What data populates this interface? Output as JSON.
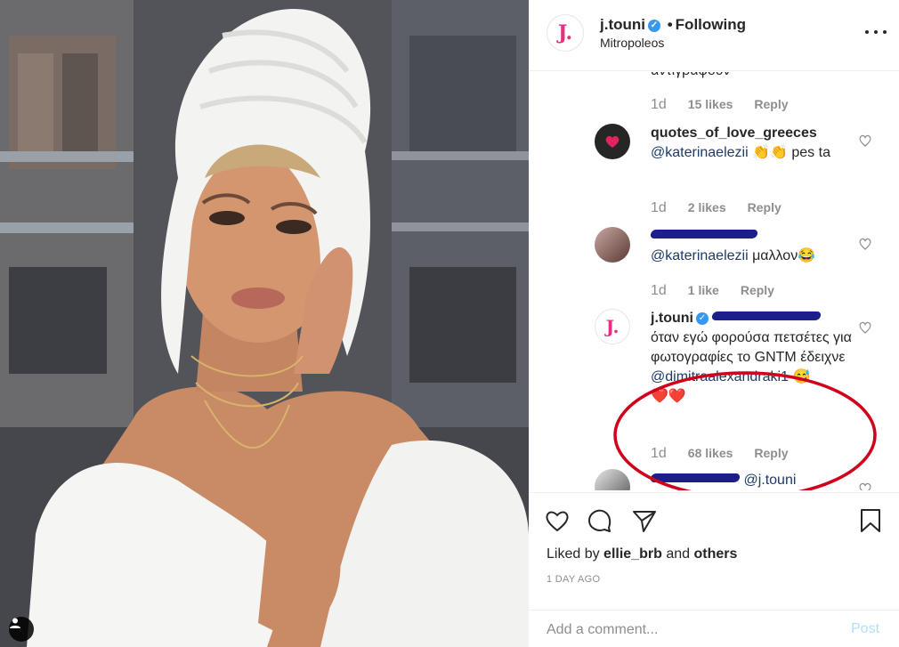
{
  "post": {
    "username": "j.touni",
    "avatar_letter": "J.",
    "follow_status": "Following",
    "location": "Mitropoleos"
  },
  "comments": {
    "fragment_text": "αντιγραφουν",
    "first_meta": {
      "ago": "1d",
      "likes": "15 likes",
      "reply": "Reply"
    },
    "items": [
      {
        "username": "quotes_of_love_greeces",
        "mention": "@katerinaelezii",
        "emoji": "👏👏",
        "text": "pes ta",
        "ago": "1d",
        "likes": "2 likes",
        "reply": "Reply"
      },
      {
        "username_redacted": true,
        "mention": "@katerinaelezii",
        "text": "μαλλον",
        "emoji": "😂",
        "ago": "1d",
        "likes": "1 like",
        "reply": "Reply"
      },
      {
        "username": "j.touni",
        "mention_redacted": true,
        "text": "όταν εγώ φορούσα πετσέτες για φωτογραφίες το GNTM έδειχνε",
        "mention": "@dimitraalexandraki1",
        "emoji": "😅",
        "emoji_after": "❤️❤️",
        "ago": "1d",
        "likes": "68 likes",
        "reply": "Reply"
      },
      {
        "username_redacted": true,
        "mention": "@j.touni"
      }
    ]
  },
  "liked_by": {
    "prefix": "Liked by",
    "user": "ellie_brb",
    "and": "and",
    "others": "others"
  },
  "date": "1 DAY AGO",
  "add_comment": {
    "placeholder": "Add a comment...",
    "post_label": "Post"
  },
  "icons": [
    "heart-icon",
    "comment-icon",
    "share-icon",
    "bookmark-icon",
    "more-icon",
    "user-tag-icon"
  ],
  "colors": {
    "verified": "#3897f0",
    "highlight_ring": "#d0021b",
    "post_disabled": "#b2dffc",
    "brand_pink": "#e0327f"
  }
}
